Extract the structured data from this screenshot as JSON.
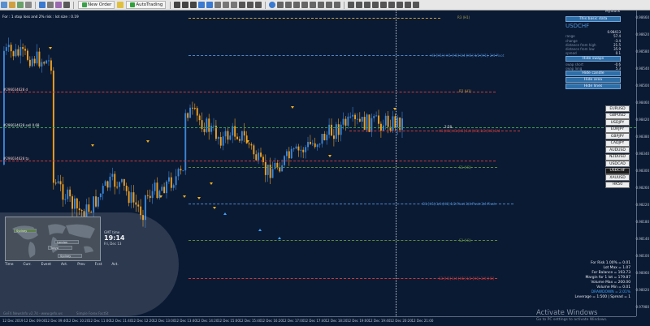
{
  "toolbar": {
    "new_order": "New Order",
    "auto_trading": "AutoTrading"
  },
  "info_line": "For : 1 stop loss and 2% risk : lot size : 0.19",
  "panel_tag": "MyStuck",
  "panel": {
    "title_button": "This basic data",
    "symbol": "USDCHF",
    "price": "0.98413",
    "rows": [
      {
        "label": "range",
        "value": "57.4"
      },
      {
        "label": "change",
        "value": "-3.4"
      },
      {
        "label": "distance from high",
        "value": "21.5"
      },
      {
        "label": "distance from low",
        "value": "35.9"
      },
      {
        "label": "spread",
        "value": "0.1"
      }
    ],
    "hide_swaps": "Hide swaps",
    "swap_rows": [
      {
        "label": "swap short",
        "value": "-0.6"
      },
      {
        "label": "swap long",
        "value": "5.3"
      }
    ],
    "hide_candle": "Hide candle",
    "hide_area": "Hide area",
    "hide_lines": "Hide lines"
  },
  "symbols": [
    {
      "name": "EURUSD",
      "selected": false
    },
    {
      "name": "GBPUSD",
      "selected": false
    },
    {
      "name": "USDJPY",
      "selected": false
    },
    {
      "name": "EURJPY",
      "selected": false
    },
    {
      "name": "GBPJPY",
      "selected": false
    },
    {
      "name": "CADJPY",
      "selected": false
    },
    {
      "name": "AUDUSD",
      "selected": false
    },
    {
      "name": "NZDUSD",
      "selected": false
    },
    {
      "name": "USDCAD",
      "selected": false
    },
    {
      "name": "USDCHF",
      "selected": true
    },
    {
      "name": "XAUUSD",
      "selected": false
    },
    {
      "name": "HK50",
      "selected": false
    }
  ],
  "level_labels": {
    "r3": "R3 (H1)",
    "h1": "H1 [H1] / H1 [H1] 1/4 [H1] 1/2 [H1], 2/4 Pivot",
    "r2": "R2 (H1)",
    "sell": "H1 [H1] H1 [H1] 1/4 [H1] 1/2 [H1] 3/4",
    "current": "2:58",
    "s1": "S1 (H1)",
    "d1": "D1 [H1] 1/4 [H1] 1/2 Pivot 3/4 Pivot 3/4 Pivot",
    "s2": "S2 (H1)",
    "s3": "S3 [H1] 1/4 [H1] 1/2 [H1] 3/4 [H1]",
    "order_d": "#296034628 d",
    "order_sell": "#296034628 sell 0.68",
    "order_tp": "#296034628 tp"
  },
  "risk": {
    "lines": [
      "For Risk 1.00% = 0.01",
      "Lot Max = 1.07",
      "For Balance = 193.73",
      "Margin for 1 lot = 179.87",
      "Volume Max = 200.00",
      "Volume Min = 0.01"
    ],
    "drawdown": "DRAWDOWN = 2.01%",
    "leverage": "Leverage = 1:500 | Spread = 1"
  },
  "widget": {
    "clock_label": "GMT time",
    "clock": "19:14",
    "date": "Fri, Dec 13",
    "sessions": [
      "Sydney",
      "London",
      "Tokyo",
      "Sydney"
    ],
    "tabs": [
      "Time",
      "Curr.",
      "Event",
      "Act.",
      "Prev",
      "Fcst",
      "Act."
    ],
    "footer": "GeFX NewsInfo v2.74 - www.gefx.ws",
    "footer2": "Simple Forex FactSt"
  },
  "y_axis": [
    "0.98660",
    "0.98620",
    "0.98580",
    "0.98540",
    "0.98500",
    "0.98460",
    "0.98420",
    "0.98380",
    "0.98340",
    "0.98300",
    "0.98260",
    "0.98220",
    "0.98180",
    "0.98140",
    "0.98100",
    "0.98060",
    "0.98020",
    "0.97980"
  ],
  "x_axis": [
    "12 Dec 2019",
    "12 Dec 09:00",
    "12 Dec 09:40",
    "12 Dec 10:20",
    "12 Dec 11:00",
    "12 Dec 11:40",
    "12 Dec 12:20",
    "12 Dec 13:00",
    "12 Dec 13:40",
    "12 Dec 14:20",
    "12 Dec 15:00",
    "12 Dec 15:40",
    "12 Dec 16:20",
    "12 Dec 17:00",
    "12 Dec 17:40",
    "12 Dec 18:20",
    "12 Dec 19:00",
    "12 Dec 19:40",
    "12 Dec 20:20",
    "12 Dec 21:00"
  ],
  "activation": {
    "title": "Activate Windows",
    "subtitle": "Go to PC settings to activate Windows."
  },
  "colors": {
    "background": "#0b1a33",
    "bull": "#3a86d8",
    "bear": "#f0a020",
    "resistance": "#c83a3a",
    "support": "#5a8a3a",
    "pivot": "#4a86c8",
    "accent": "#2f6fa8"
  },
  "icons": [
    "new-order-icon",
    "autotrading-icon",
    "settings-icon",
    "crosshair-icon",
    "zoom-in-icon",
    "zoom-out-icon"
  ]
}
